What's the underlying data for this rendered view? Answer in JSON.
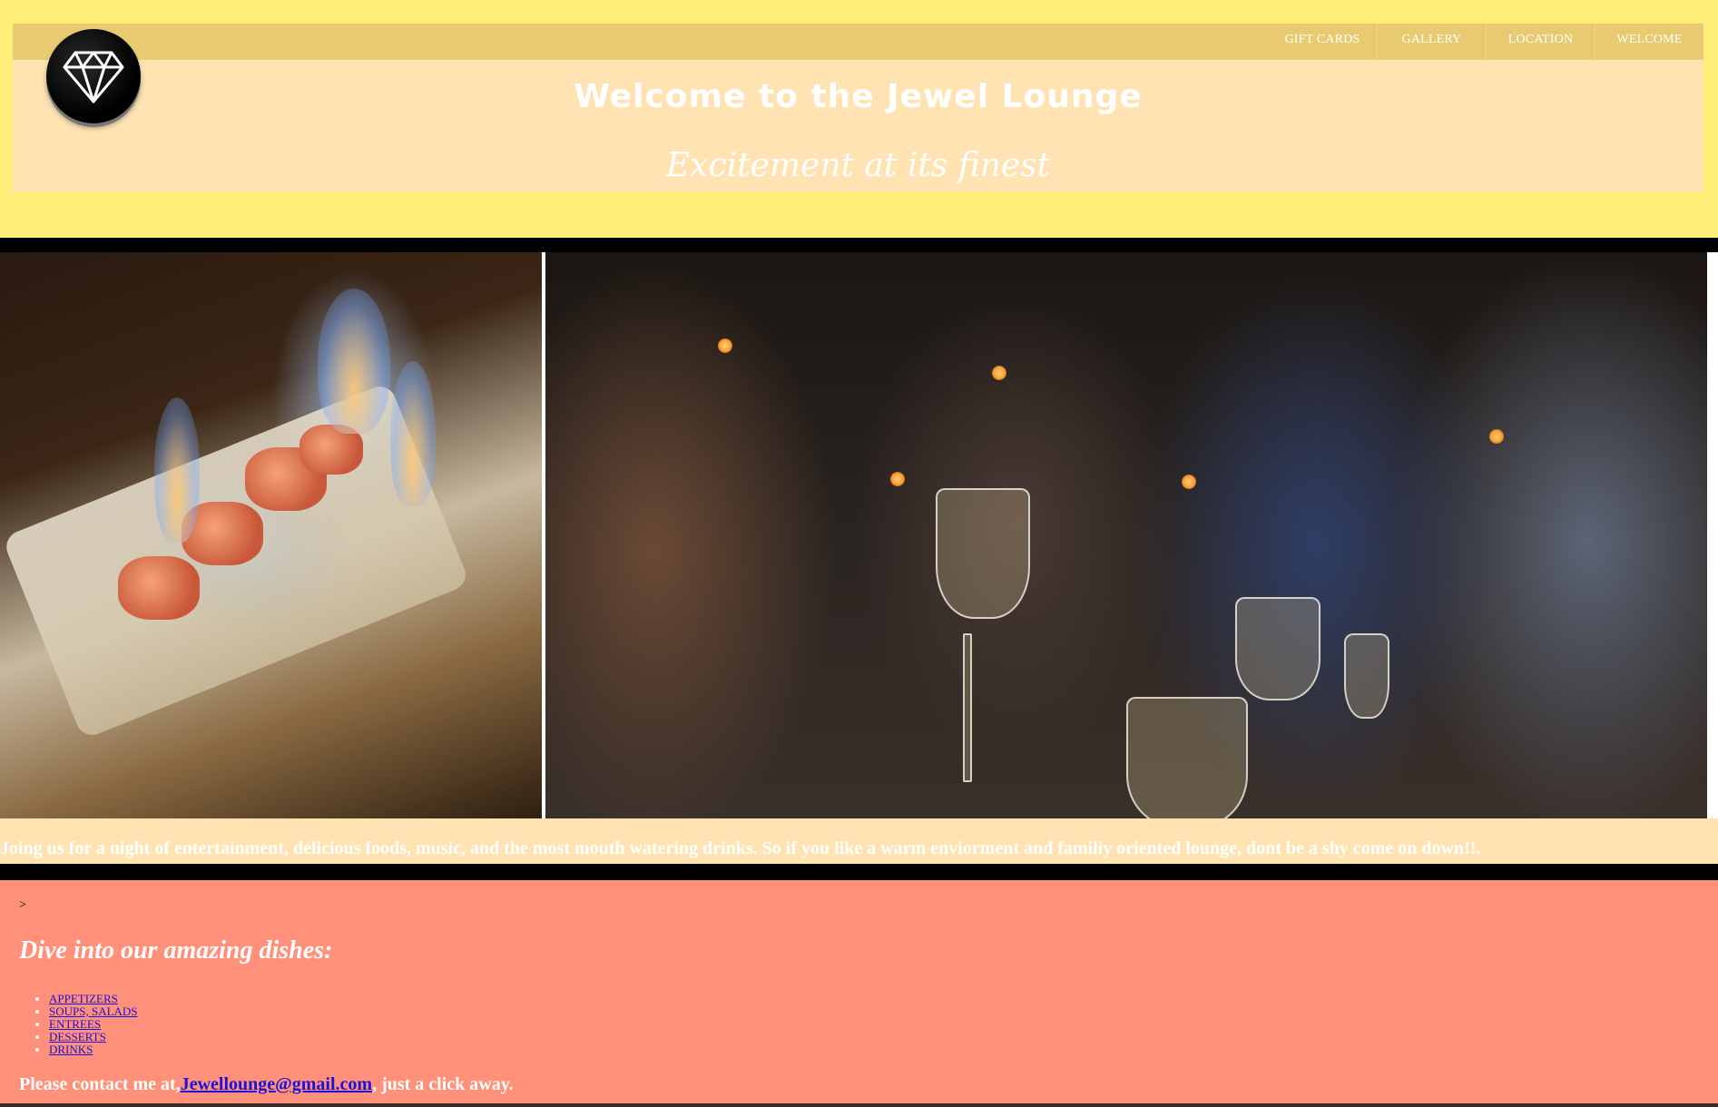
{
  "header": {
    "nav": [
      {
        "label": "GIFT CARDS"
      },
      {
        "label": "GALLERY"
      },
      {
        "label": "LOCATION"
      },
      {
        "label": "WELCOME"
      }
    ],
    "title": "Welcome to the Jewel Lounge",
    "tagline": "Excitement at its finest",
    "logo_icon": "diamond-icon"
  },
  "intro": {
    "text": "Joing us for a night of entertainment, delicious foods, music, and the most mouth watering drinks. So if you like a warm enviorment and familiy oriented lounge, dont be a shy come on down!!."
  },
  "menu": {
    "stray": ">",
    "heading": "Dive into our amazing dishes:",
    "items": [
      {
        "label": "APPETIZERS"
      },
      {
        "label": "SOUPS, SALADS"
      },
      {
        "label": "ENTREES"
      },
      {
        "label": "DESSERTS"
      },
      {
        "label": "DRINKS"
      }
    ]
  },
  "contact": {
    "prefix": "Please contact me at,",
    "email": "Jewellounge@gmail.com",
    "suffix": ", just a click away."
  },
  "colors": {
    "header_band": "#ffee77",
    "header_panel": "#ffe3b3",
    "nav_bar": "#e8ca70",
    "menu_section": "#ff917a",
    "link": "#1a10d9"
  }
}
